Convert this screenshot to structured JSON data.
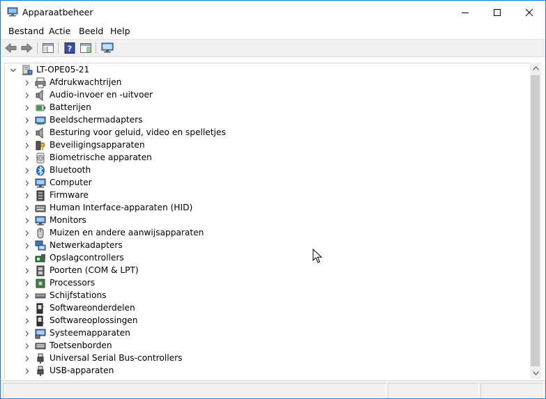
{
  "window": {
    "title": "Apparaatbeheer"
  },
  "menu": {
    "file": "Bestand",
    "action": "Actie",
    "view": "Beeld",
    "help": "Help"
  },
  "tree": {
    "root": "LT-OPE05-21",
    "items": [
      {
        "label": "Afdrukwachtrijen",
        "icon": "printer-queue-icon"
      },
      {
        "label": "Audio-invoer en -uitvoer",
        "icon": "speaker-icon"
      },
      {
        "label": "Batterijen",
        "icon": "battery-icon"
      },
      {
        "label": "Beeldschermadapters",
        "icon": "display-adapter-icon"
      },
      {
        "label": "Besturing voor geluid, video en spelletjes",
        "icon": "sound-video-icon"
      },
      {
        "label": "Beveiligingsapparaten",
        "icon": "security-key-icon"
      },
      {
        "label": "Biometrische apparaten",
        "icon": "fingerprint-icon"
      },
      {
        "label": "Bluetooth",
        "icon": "bluetooth-icon"
      },
      {
        "label": "Computer",
        "icon": "computer-icon"
      },
      {
        "label": "Firmware",
        "icon": "firmware-chip-icon"
      },
      {
        "label": "Human Interface-apparaten (HID)",
        "icon": "hid-keyboard-icon"
      },
      {
        "label": "Monitors",
        "icon": "monitor-icon"
      },
      {
        "label": "Muizen en andere aanwijsapparaten",
        "icon": "mouse-icon"
      },
      {
        "label": "Netwerkadapters",
        "icon": "network-adapter-icon"
      },
      {
        "label": "Opslagcontrollers",
        "icon": "storage-controller-icon"
      },
      {
        "label": "Poorten (COM & LPT)",
        "icon": "port-icon"
      },
      {
        "label": "Processors",
        "icon": "processor-icon"
      },
      {
        "label": "Schijfstations",
        "icon": "disk-drive-icon"
      },
      {
        "label": "Softwareonderdelen",
        "icon": "software-component-icon"
      },
      {
        "label": "Softwareoplossingen",
        "icon": "software-device-icon"
      },
      {
        "label": "Systeemapparaten",
        "icon": "system-device-icon"
      },
      {
        "label": "Toetsenborden",
        "icon": "keyboard-icon"
      },
      {
        "label": "Universal Serial Bus-controllers",
        "icon": "usb-controller-icon"
      },
      {
        "label": "USB-apparaten",
        "icon": "usb-device-icon"
      }
    ]
  },
  "colors": {
    "accent": "#1e7bd6",
    "thumb": "#cdcdcd",
    "toolbar": "#f0f0f0"
  }
}
